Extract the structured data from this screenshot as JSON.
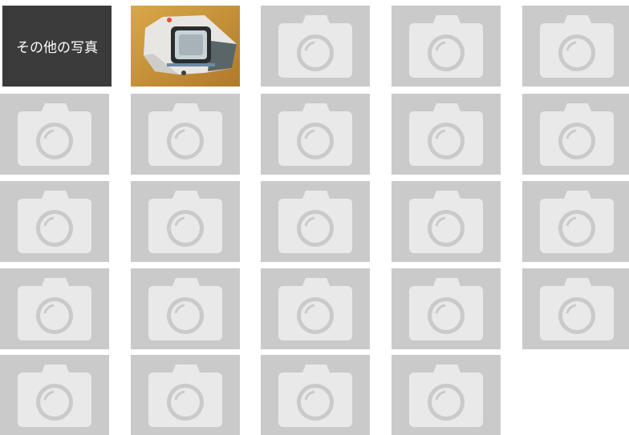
{
  "gallery": {
    "other_photos_label": "その他の写真",
    "photo_count": 1,
    "placeholder_count": 22,
    "placeholder_icon": "camera-icon",
    "colors": {
      "placeholder_bg": "#cacaca",
      "placeholder_icon": "#e9e9e9",
      "label_bg": "#3a3b3a",
      "label_text": "#ffffff"
    }
  }
}
